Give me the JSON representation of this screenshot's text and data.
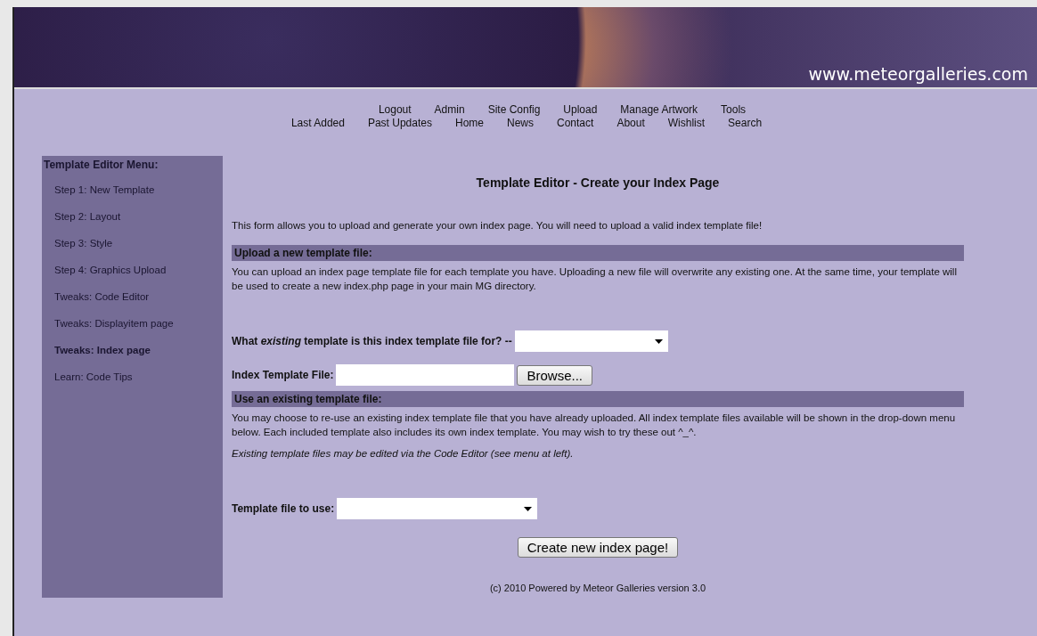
{
  "header": {
    "site_url": "www.meteorgalleries.com"
  },
  "nav": {
    "admin_links": [
      "Logout",
      "Admin",
      "Site Config",
      "Upload",
      "Manage Artwork",
      "Tools"
    ],
    "site_links": [
      "Last Added",
      "Past Updates",
      "Home",
      "News",
      "Contact",
      "About",
      "Wishlist",
      "Search"
    ]
  },
  "sidebar": {
    "title": "Template Editor Menu:",
    "items": [
      {
        "label": "Step 1: New Template",
        "selected": false
      },
      {
        "label": "Step 2: Layout",
        "selected": false
      },
      {
        "label": "Step 3: Style",
        "selected": false
      },
      {
        "label": "Step 4: Graphics Upload",
        "selected": false
      },
      {
        "label": "Tweaks: Code Editor",
        "selected": false
      },
      {
        "label": "Tweaks: Displayitem page",
        "selected": false
      },
      {
        "label": "Tweaks: Index page",
        "selected": true
      },
      {
        "label": "Learn: Code Tips",
        "selected": false
      }
    ]
  },
  "main": {
    "title": "Template Editor - Create your Index Page",
    "intro": "This form allows you to upload and generate your own index page. You will need to upload a valid index template file!",
    "sections": [
      {
        "heading": "Upload a new template file:",
        "paragraphs": [
          {
            "text": "You can upload an index page template file for each template you have. Uploading a new file will overwrite any existing one. At the same time, your template will be used to create a new index.php page in your main MG directory.",
            "italic": false
          }
        ],
        "fields": [
          {
            "kind": "select",
            "label": "What *existing* template is this index template file for? --"
          },
          {
            "kind": "file",
            "label": "Index Template File:",
            "button": "Browse..."
          }
        ]
      },
      {
        "heading": "Use an existing template file:",
        "paragraphs": [
          {
            "text": "You may choose to re-use an existing index template file that you have already uploaded. All index template files available will be shown in the drop-down menu below. Each included template also includes its own index template. You may wish to try these out ^_^.",
            "italic": false
          },
          {
            "text": "Existing template files may be edited via the Code Editor (see menu at left).",
            "italic": true
          }
        ],
        "fields": [
          {
            "kind": "select",
            "label": "Template file to use:"
          }
        ]
      }
    ],
    "submit": "Create new index page!"
  },
  "footer": "(c) 2010 Powered by Meteor Galleries version 3.0"
}
